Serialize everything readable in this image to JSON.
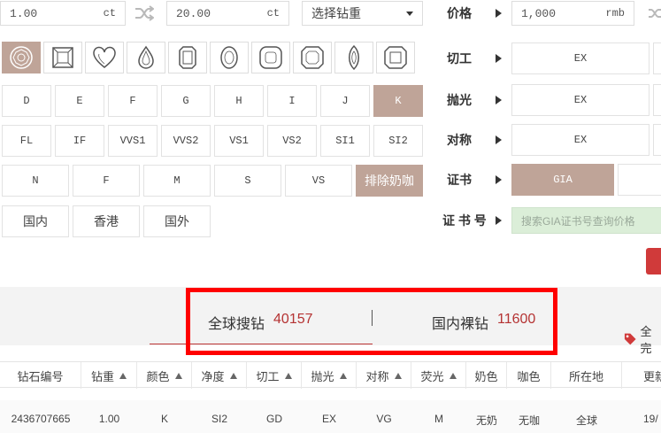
{
  "carat_range": {
    "min": "1.00",
    "min_unit": "ct",
    "max": "20.00",
    "max_unit": "ct"
  },
  "carat_select": {
    "value": "选择钻重"
  },
  "price": {
    "label": "价格",
    "min": "1,000",
    "unit": "rmb"
  },
  "shapes": [
    {
      "name": "round-shape-icon",
      "active": true
    },
    {
      "name": "princess-shape-icon",
      "active": false
    },
    {
      "name": "heart-shape-icon",
      "active": false
    },
    {
      "name": "pear-shape-icon",
      "active": false
    },
    {
      "name": "emerald-shape-icon",
      "active": false
    },
    {
      "name": "oval-shape-icon",
      "active": false
    },
    {
      "name": "cushion-shape-icon",
      "active": false
    },
    {
      "name": "radiant-shape-icon",
      "active": false
    },
    {
      "name": "marquise-shape-icon",
      "active": false
    },
    {
      "name": "asscher-shape-icon",
      "active": false
    }
  ],
  "colors": [
    "D",
    "E",
    "F",
    "G",
    "H",
    "I",
    "J",
    "K"
  ],
  "active_color": "K",
  "clarity": [
    "FL",
    "IF",
    "VVS1",
    "VVS2",
    "VS1",
    "VS2",
    "SI1",
    "SI2"
  ],
  "fluorescence": [
    "N",
    "F",
    "M",
    "S",
    "VS"
  ],
  "exclude_milky": "排除奶咖",
  "origin": [
    "国内",
    "香港",
    "国外"
  ],
  "filters": {
    "cut": {
      "label": "切工",
      "value": "EX"
    },
    "polish": {
      "label": "抛光",
      "value": "EX"
    },
    "symmetry": {
      "label": "对称",
      "value": "EX"
    },
    "cert": {
      "label": "证书",
      "value": "GIA"
    },
    "cert_no": {
      "label": "证 书 号",
      "placeholder": "搜索GIA证书号查询价格"
    }
  },
  "tabs": [
    {
      "label": "全球搜钻",
      "count": "40157"
    },
    {
      "label": "国内裸钻",
      "count": "11600"
    }
  ],
  "tag_label": "全完",
  "table": {
    "headers": [
      "钻石编号",
      "钻重",
      "颜色",
      "净度",
      "切工",
      "抛光",
      "对称",
      "荧光",
      "奶色",
      "咖色",
      "所在地",
      "更新"
    ],
    "row": [
      "2436707665",
      "1.00",
      "K",
      "SI2",
      "GD",
      "EX",
      "VG",
      "M",
      "无奶",
      "无咖",
      "全球",
      "19/"
    ]
  },
  "colors_theme": {
    "accent": "#bfa498",
    "highlight_border": "#ff0000",
    "count_red": "#b53333",
    "cert_bg": "#dbeed8"
  }
}
